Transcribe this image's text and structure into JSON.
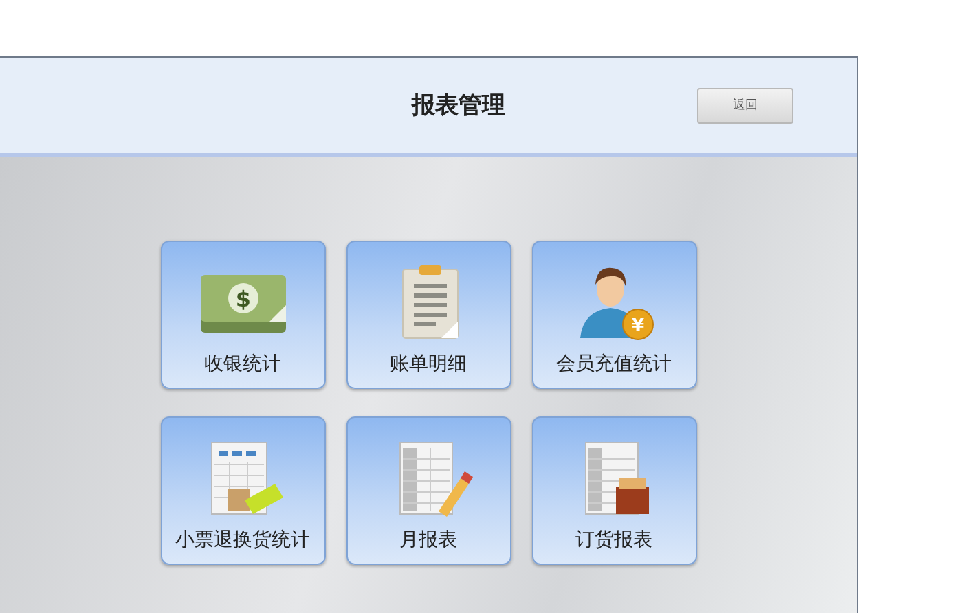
{
  "window": {
    "title": "报表管理",
    "back_button": "返回"
  },
  "tiles": [
    {
      "kind": "money",
      "symbol": "$",
      "label": "收银统计"
    },
    {
      "kind": "clipboard",
      "label": "账单明细"
    },
    {
      "kind": "member",
      "symbol": "¥",
      "label": "会员充值统计"
    },
    {
      "kind": "receipt",
      "label": "小票退换货统计"
    },
    {
      "kind": "monthly",
      "label": "月报表"
    },
    {
      "kind": "order",
      "label": "订货报表"
    }
  ]
}
